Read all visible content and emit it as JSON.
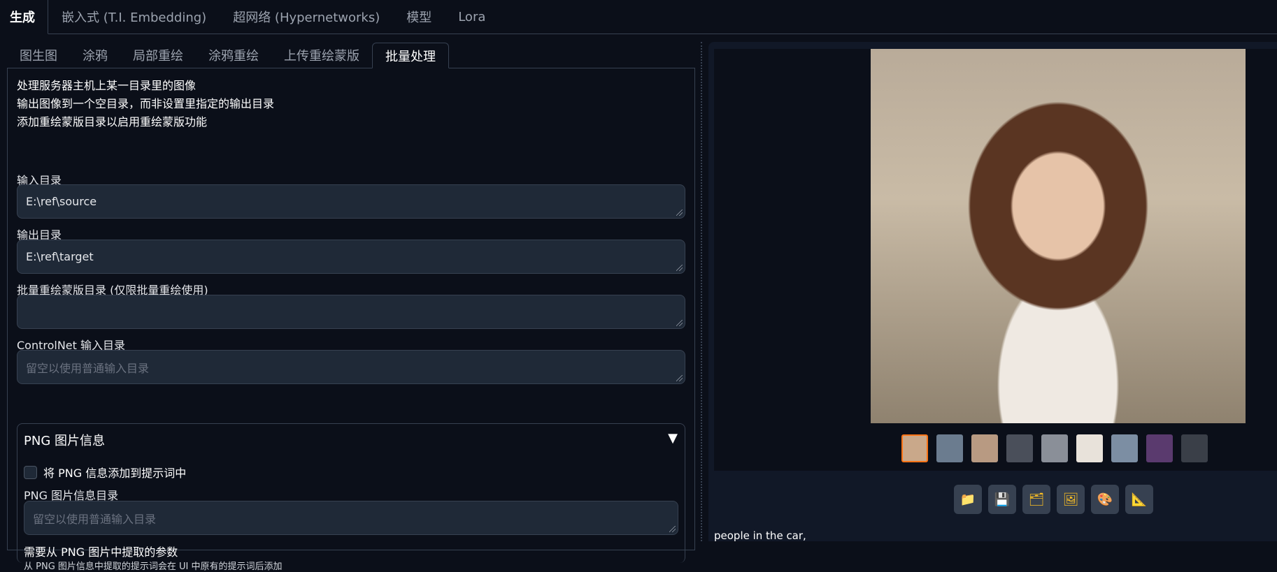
{
  "top_tabs": [
    "生成",
    "嵌入式 (T.I. Embedding)",
    "超网络 (Hypernetworks)",
    "模型",
    "Lora"
  ],
  "sub_tabs": [
    "图生图",
    "涂鸦",
    "局部重绘",
    "涂鸦重绘",
    "上传重绘蒙版",
    "批量处理"
  ],
  "info_lines": [
    "处理服务器主机上某一目录里的图像",
    "输出图像到一个空目录，而非设置里指定的输出目录",
    "添加重绘蒙版目录以启用重绘蒙版功能"
  ],
  "input_dir": {
    "label": "输入目录",
    "value": "E:\\ref\\source"
  },
  "output_dir": {
    "label": "输出目录",
    "value": "E:\\ref\\target"
  },
  "mask_dir": {
    "label": "批量重绘蒙版目录 (仅限批量重绘使用)",
    "value": ""
  },
  "controlnet_dir": {
    "label": "ControlNet 输入目录",
    "placeholder": "留空以使用普通输入目录"
  },
  "png_info": {
    "title": "PNG 图片信息",
    "arrow": "▼",
    "checkbox_label": "将 PNG 信息添加到提示词中",
    "dir_label": "PNG 图片信息目录",
    "dir_placeholder": "留空以使用普通输入目录",
    "params_label": "需要从 PNG 图片中提取的参数",
    "params_hint": "从 PNG 图片信息中提取的提示词会在 UI 中原有的提示词后添加"
  },
  "gallery": {
    "thumb_colors": [
      "#c9a88a",
      "#6b7c8f",
      "#b89a82",
      "#4a4f5a",
      "#8a8f98",
      "#e8e2da",
      "#7c8ea3",
      "#5a3a6e",
      "#3a3f48"
    ]
  },
  "toolbar_icons": [
    "folder-icon",
    "save-icon",
    "zip-icon",
    "image-icon",
    "palette-icon",
    "ruler-icon"
  ],
  "caption": "people in the car,"
}
